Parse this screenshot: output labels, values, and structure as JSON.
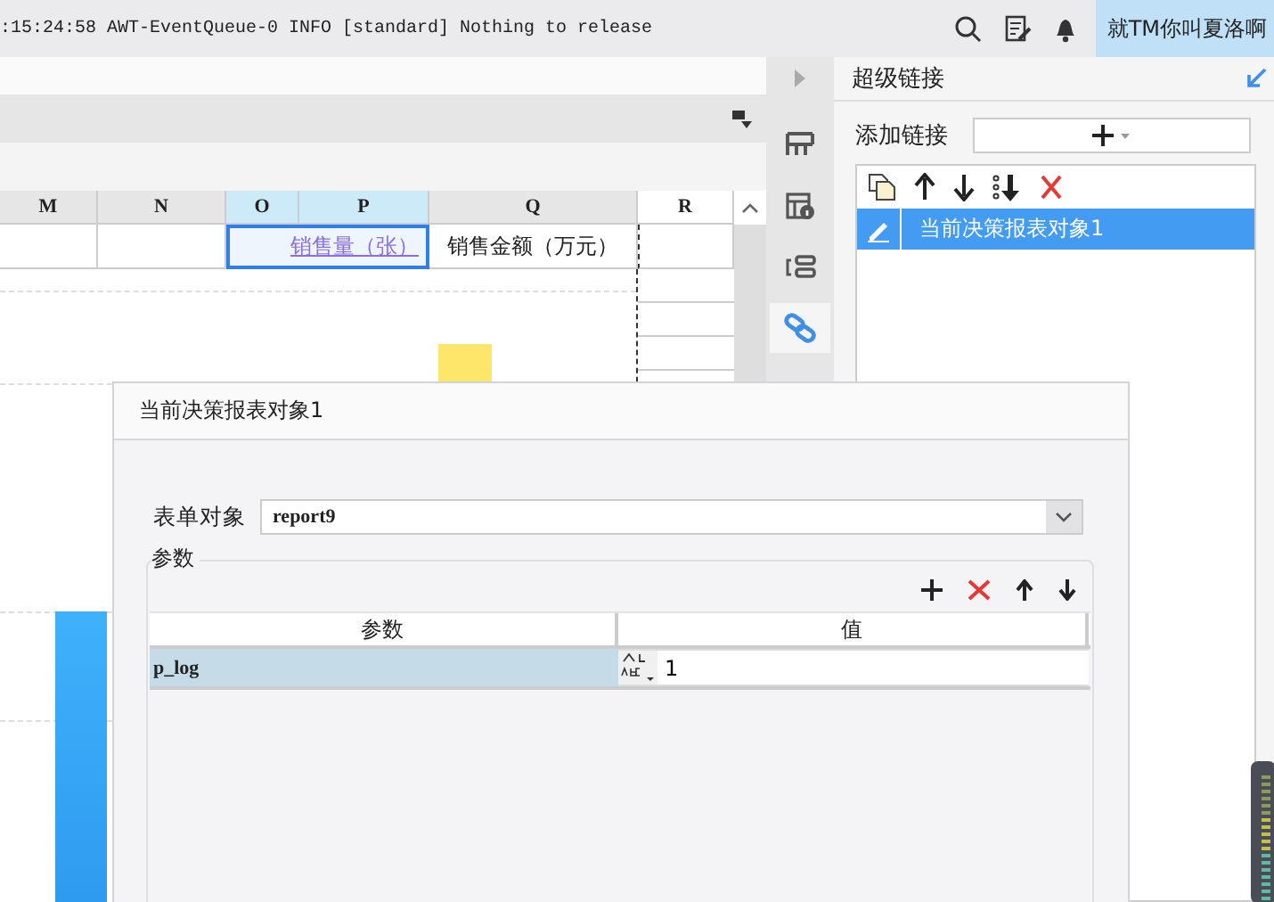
{
  "status_bar": {
    "log": ":15:24:58 AWT-EventQueue-0 INFO [standard] Nothing to release",
    "user": "就TM你叫夏洛啊"
  },
  "sheet": {
    "columns": [
      {
        "label": "M",
        "selected": false
      },
      {
        "label": "N",
        "selected": false
      },
      {
        "label": "O",
        "selected": true
      },
      {
        "label": "P",
        "selected": true
      },
      {
        "label": "Q",
        "selected": false
      },
      {
        "label": "R",
        "selected": false
      }
    ],
    "cells": [
      {
        "text": "销售量（张）",
        "kind": "link",
        "selected": true
      },
      {
        "text": "销售金额（万元）",
        "kind": "plain",
        "selected": false
      }
    ]
  },
  "side_tabs": [
    {
      "selected": false
    },
    {
      "selected": false
    },
    {
      "selected": false
    },
    {
      "selected": true
    }
  ],
  "hyperlink_panel": {
    "title": "超级链接",
    "add_label": "添加链接",
    "items": [
      {
        "label": "当前决策报表对象1",
        "selected": true
      }
    ]
  },
  "dialog": {
    "title": "当前决策报表对象1",
    "form_label": "表单对象",
    "form_value": "report9",
    "params_legend": "参数",
    "columns": [
      "参数",
      "值"
    ],
    "rows": [
      {
        "name": "p_log",
        "value": "1",
        "selected": true
      }
    ]
  }
}
